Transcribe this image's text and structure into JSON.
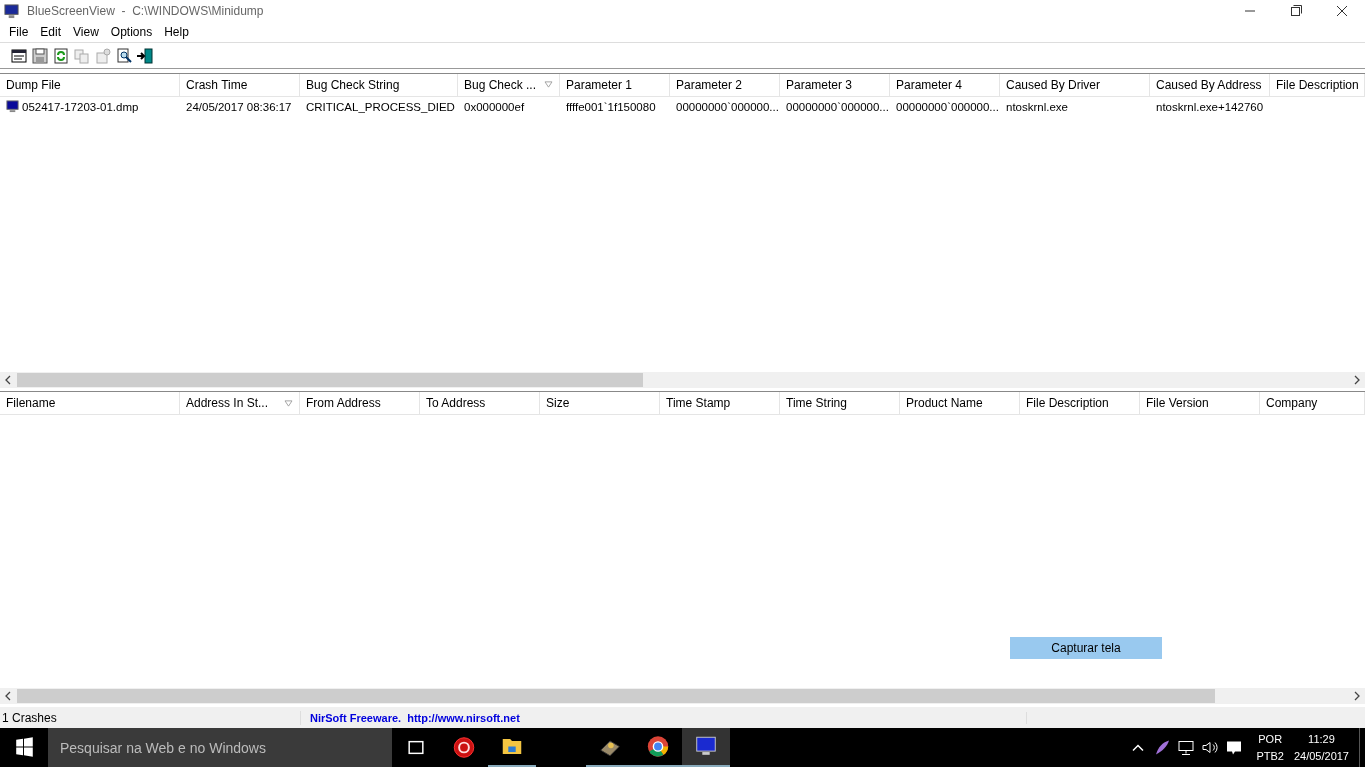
{
  "window": {
    "title": "BlueScreenView  -  C:\\WINDOWS\\Minidump"
  },
  "menu": [
    "File",
    "Edit",
    "View",
    "Options",
    "Help"
  ],
  "crash_list": {
    "columns": [
      {
        "label": "Dump File",
        "sorted": false
      },
      {
        "label": "Crash Time",
        "sorted": false
      },
      {
        "label": "Bug Check String",
        "sorted": false
      },
      {
        "label": "Bug Check ...",
        "sorted": true
      },
      {
        "label": "Parameter 1",
        "sorted": false
      },
      {
        "label": "Parameter 2",
        "sorted": false
      },
      {
        "label": "Parameter 3",
        "sorted": false
      },
      {
        "label": "Parameter 4",
        "sorted": false
      },
      {
        "label": "Caused By Driver",
        "sorted": false
      },
      {
        "label": "Caused By Address",
        "sorted": false
      },
      {
        "label": "File Description",
        "sorted": false
      }
    ],
    "rows": [
      {
        "cells": [
          "052417-17203-01.dmp",
          "24/05/2017 08:36:17",
          "CRITICAL_PROCESS_DIED",
          "0x000000ef",
          "ffffe001`1f150080",
          "00000000`000000...",
          "00000000`000000...",
          "00000000`000000...",
          "ntoskrnl.exe",
          "ntoskrnl.exe+142760",
          ""
        ]
      }
    ]
  },
  "driver_list": {
    "columns": [
      {
        "label": "Filename",
        "sorted": false
      },
      {
        "label": "Address In St...",
        "sorted": true
      },
      {
        "label": "From Address",
        "sorted": false
      },
      {
        "label": "To Address",
        "sorted": false
      },
      {
        "label": "Size",
        "sorted": false
      },
      {
        "label": "Time Stamp",
        "sorted": false
      },
      {
        "label": "Time String",
        "sorted": false
      },
      {
        "label": "Product Name",
        "sorted": false
      },
      {
        "label": "File Description",
        "sorted": false
      },
      {
        "label": "File Version",
        "sorted": false
      },
      {
        "label": "Company",
        "sorted": false
      }
    ]
  },
  "capture_button": "Capturar tela",
  "status_bar": {
    "count": "1 Crashes",
    "credit": "NirSoft Freeware.  http://www.nirsoft.net"
  },
  "taskbar": {
    "search_placeholder": "Pesquisar na Web e no Windows",
    "language": "POR",
    "layout": "PTB2",
    "time": "11:29",
    "date": "24/05/2017"
  }
}
